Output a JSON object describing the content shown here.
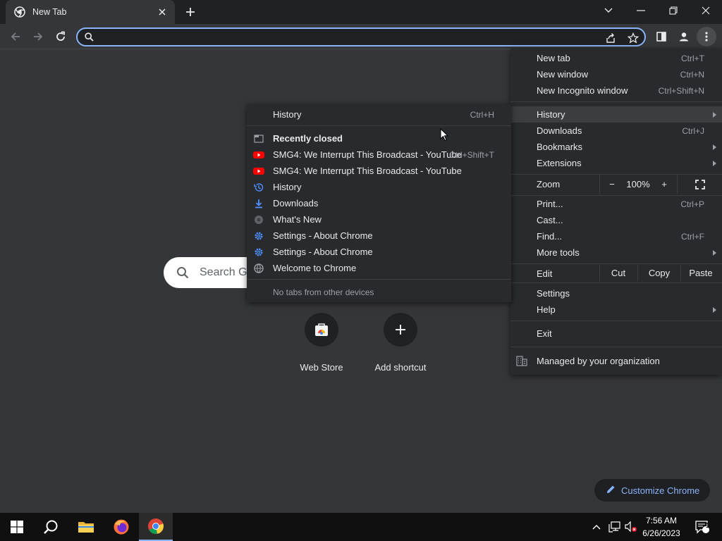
{
  "tab": {
    "title": "New Tab"
  },
  "omnibox": {
    "value": "",
    "placeholder": ""
  },
  "ntp": {
    "search_placeholder": "Search G",
    "shortcuts": [
      {
        "label": "Web Store"
      },
      {
        "label": "Add shortcut"
      }
    ],
    "customize_label": "Customize Chrome"
  },
  "main_menu": {
    "new_tab": {
      "label": "New tab",
      "shortcut": "Ctrl+T"
    },
    "new_window": {
      "label": "New window",
      "shortcut": "Ctrl+N"
    },
    "incognito": {
      "label": "New Incognito window",
      "shortcut": "Ctrl+Shift+N"
    },
    "history": {
      "label": "History"
    },
    "downloads": {
      "label": "Downloads",
      "shortcut": "Ctrl+J"
    },
    "bookmarks": {
      "label": "Bookmarks"
    },
    "extensions": {
      "label": "Extensions"
    },
    "zoom": {
      "label": "Zoom",
      "minus": "−",
      "value": "100%",
      "plus": "+"
    },
    "print": {
      "label": "Print...",
      "shortcut": "Ctrl+P"
    },
    "cast": {
      "label": "Cast..."
    },
    "find": {
      "label": "Find...",
      "shortcut": "Ctrl+F"
    },
    "more_tools": {
      "label": "More tools"
    },
    "edit": {
      "label": "Edit",
      "cut": "Cut",
      "copy": "Copy",
      "paste": "Paste"
    },
    "settings": {
      "label": "Settings"
    },
    "help": {
      "label": "Help"
    },
    "exit": {
      "label": "Exit"
    },
    "managed": {
      "label": "Managed by your organization"
    }
  },
  "history_menu": {
    "history": {
      "label": "History",
      "shortcut": "Ctrl+H"
    },
    "recently_closed": {
      "label": "Recently closed"
    },
    "items": [
      {
        "label": "SMG4: We Interrupt This Broadcast - YouTube",
        "shortcut": "Ctrl+Shift+T",
        "icon": "youtube-icon"
      },
      {
        "label": "SMG4: We Interrupt This Broadcast - YouTube",
        "shortcut": "",
        "icon": "youtube-icon"
      },
      {
        "label": "History",
        "shortcut": "",
        "icon": "history-icon"
      },
      {
        "label": "Downloads",
        "shortcut": "",
        "icon": "download-icon"
      },
      {
        "label": "What's New",
        "shortcut": "",
        "icon": "chrome-icon"
      },
      {
        "label": "Settings - About Chrome",
        "shortcut": "",
        "icon": "settings-gear-icon"
      },
      {
        "label": "Settings - About Chrome",
        "shortcut": "",
        "icon": "settings-gear-icon"
      },
      {
        "label": "Welcome to Chrome",
        "shortcut": "",
        "icon": "globe-icon"
      }
    ],
    "no_tabs": "No tabs from other devices"
  },
  "taskbar": {
    "time": "7:56 AM",
    "date": "6/26/2023",
    "notification_count": "1"
  },
  "colors": {
    "accent": "#8ab4f8",
    "menu_bg": "#292a2d",
    "page_bg": "#35363a",
    "youtube_red": "#ff0000"
  }
}
